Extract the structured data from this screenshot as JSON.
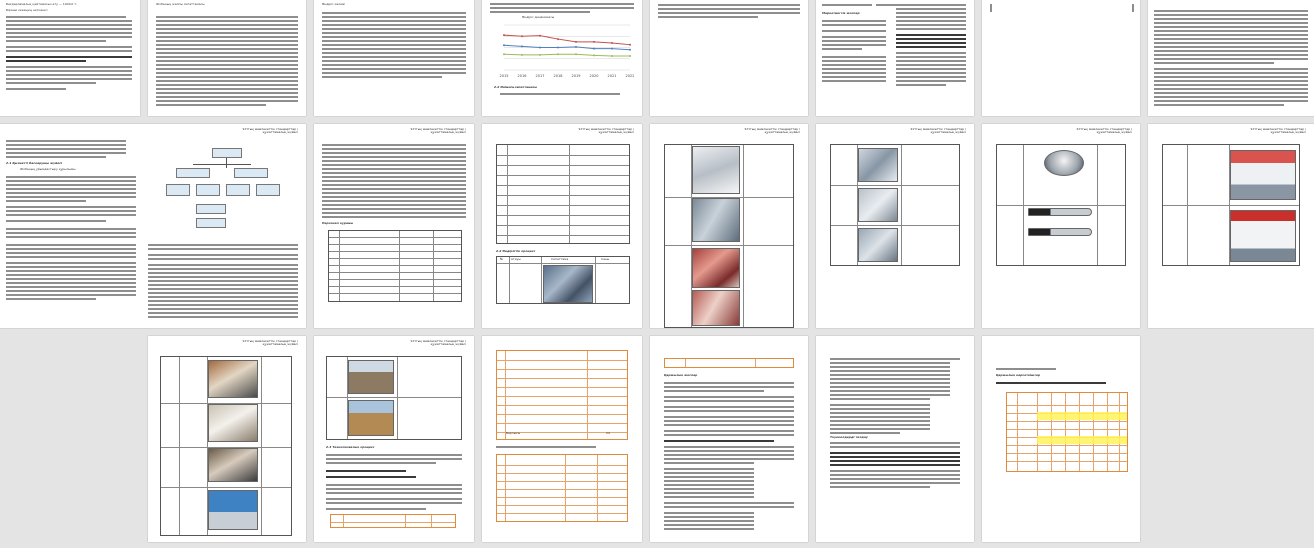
{
  "document": {
    "header_text": "Ұлттық мемлекеттік стандарттар / құжаттамалық жүйесі",
    "pages": [
      {
        "id": "p1",
        "lines": [
          "Бағдарламалық қамтамасыз ету — 1400,0 т.",
          "Бірінші кезеңнің нәтижесі"
        ]
      },
      {
        "id": "p2",
        "lines": [
          "Жобаның жалпы сипаттамасы"
        ]
      },
      {
        "id": "p3",
        "lines": [
          "Өндіріс көлемі"
        ]
      },
      {
        "id": "p4",
        "chart_title": "Өндіріс динамикасы",
        "section": "2.2 Өнімнің сипаттамасы"
      },
      {
        "id": "p5",
        "section": "Маркетингтік жоспар"
      },
      {
        "id": "p9",
        "section": "2.1 Қызметті басқарушы жүйесі",
        "subsection": "Жобаның ұйымдастыру құрылымы"
      },
      {
        "id": "p10",
        "section": "Персонал құрамы"
      },
      {
        "id": "p11",
        "table_title": "2.2 Өндірістік процесс",
        "header": [
          "№",
          "Атауы",
          "Сипаттама",
          "Саны"
        ]
      },
      {
        "id": "p16",
        "section": "2.3 Технологиялық процесс"
      },
      {
        "id": "p17",
        "totals": [
          "Барлығы",
          "24"
        ]
      },
      {
        "id": "p18",
        "section": "Қаржылық жоспар"
      },
      {
        "id": "p19",
        "section": "Тәуекелдерді талдау"
      },
      {
        "id": "p20",
        "section": "Қаржылық көрсеткіштер"
      }
    ]
  },
  "chart_data": {
    "type": "line",
    "title": "",
    "x": [
      "2015",
      "2016",
      "2017",
      "2018",
      "2019",
      "2020",
      "2021",
      "2022"
    ],
    "series": [
      {
        "values": [
          62,
          60,
          61,
          55,
          50,
          50,
          48,
          45
        ],
        "color": "#c0504d"
      },
      {
        "values": [
          44,
          42,
          40,
          40,
          41,
          38,
          38,
          36
        ],
        "color": "#4f81bd"
      },
      {
        "values": [
          28,
          27,
          27,
          28,
          28,
          26,
          25,
          25
        ],
        "color": "#9bbb59"
      }
    ],
    "ylim": [
      0,
      80
    ],
    "grid": true
  },
  "colors": {
    "page": "#ffffff",
    "background": "#e4e4e4",
    "accent_table": "#e08a3c"
  }
}
